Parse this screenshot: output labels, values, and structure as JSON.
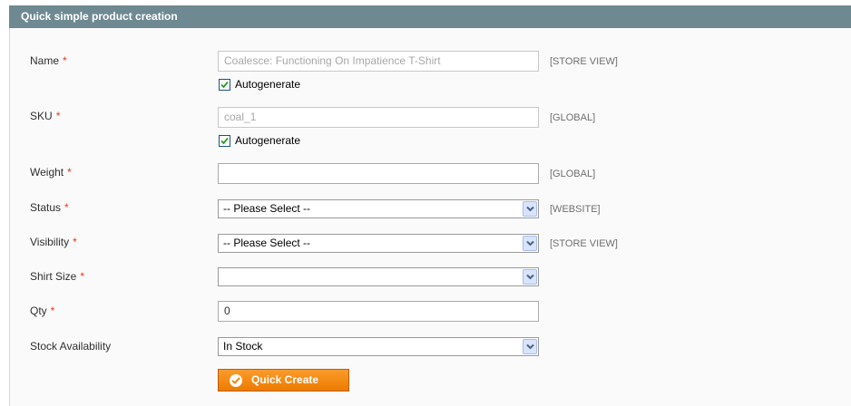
{
  "fieldset": {
    "title": "Quick simple product creation"
  },
  "required_mark": "*",
  "fields": {
    "name": {
      "label": "Name",
      "value": "Coalesce: Functioning On Impatience T-Shirt",
      "scope": "[STORE VIEW]",
      "autogenerate_label": "Autogenerate",
      "autogenerate_checked": true
    },
    "sku": {
      "label": "SKU",
      "value": "coal_1",
      "scope": "[GLOBAL]",
      "autogenerate_label": "Autogenerate",
      "autogenerate_checked": true
    },
    "weight": {
      "label": "Weight",
      "value": "",
      "scope": "[GLOBAL]"
    },
    "status": {
      "label": "Status",
      "selected": "-- Please Select --",
      "scope": "[WEBSITE]"
    },
    "visibility": {
      "label": "Visibility",
      "selected": "-- Please Select --",
      "scope": "[STORE VIEW]"
    },
    "shirt_size": {
      "label": "Shirt Size",
      "selected": ""
    },
    "qty": {
      "label": "Qty",
      "value": "0"
    },
    "stock_availability": {
      "label": "Stock Availability",
      "selected": "In Stock"
    }
  },
  "buttons": {
    "quick_create": "Quick Create"
  },
  "icons": {
    "checkbox_check": "check-icon",
    "select_arrow": "chevron-down-icon",
    "button_icon": "check-circle-icon"
  },
  "colors": {
    "header_bg": "#6f8992",
    "required": "#eb340a",
    "button_orange": "#f18200",
    "scope_text": "#6f6f6f"
  }
}
